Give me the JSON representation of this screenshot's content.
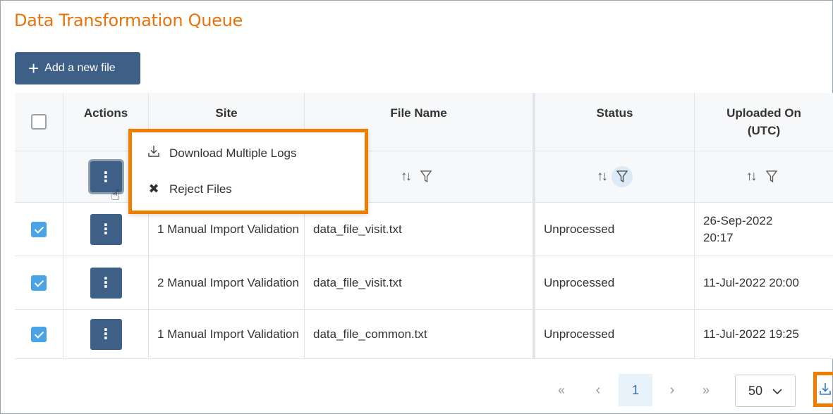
{
  "page": {
    "title": "Data Transformation Queue",
    "add_button_icon": "plus-icon",
    "add_button_label": "Add a new file"
  },
  "table": {
    "columns": [
      "Actions",
      "Site",
      "File Name",
      "Status",
      "Uploaded On\n(UTC)"
    ],
    "rows": [
      {
        "checked": true,
        "site": "1 Manual Import Validation",
        "file_name": "data_file_visit.txt",
        "status": "Unprocessed",
        "uploaded_on": "26-Sep-2022 20:17"
      },
      {
        "checked": true,
        "site": "2 Manual Import Validation",
        "file_name": "data_file_visit.txt",
        "status": "Unprocessed",
        "uploaded_on": "11-Jul-2022 20:00"
      },
      {
        "checked": true,
        "site": "1 Manual Import Validation",
        "file_name": "data_file_common.txt",
        "status": "Unprocessed",
        "uploaded_on": "11-Jul-2022 19:25"
      }
    ],
    "sort_icon": "sort-icon",
    "filter_icon": "filter-icon",
    "active_filter_column": "Status"
  },
  "actions_menu": {
    "items": [
      {
        "icon": "download-icon",
        "label": "Download Multiple Logs"
      },
      {
        "icon": "close-icon",
        "label": "Reject Files"
      }
    ]
  },
  "pagination": {
    "first": "«",
    "prev": "‹",
    "current_page": "1",
    "next": "›",
    "last": "»",
    "page_size": "50",
    "download_icon": "download-icon"
  },
  "colors": {
    "title": "#e8730c",
    "primary_button": "#3e5f86",
    "highlight_border": "#f07c00",
    "checkbox_checked": "#4aa3e6"
  }
}
